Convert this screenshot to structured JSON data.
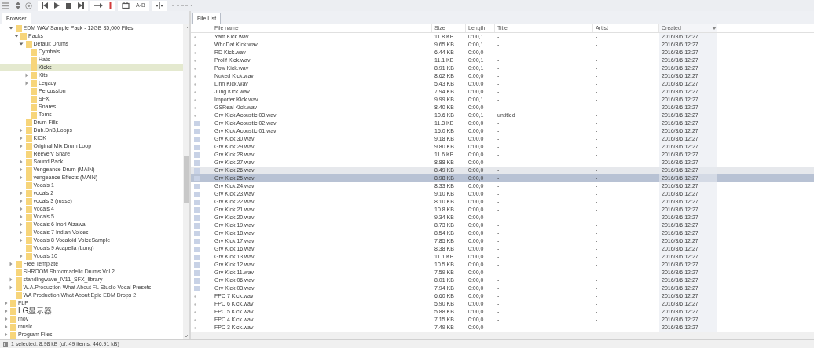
{
  "toolbar": {
    "ab_label": "A-B"
  },
  "browser_tabs": [
    {
      "label": "Browser",
      "selected": true
    }
  ],
  "tree": [
    {
      "children": [
        {
          "label": "EDM WAV Sample Pack - 12GB  35,000 Files",
          "expanded": true,
          "selected": false,
          "children": [
            {
              "label": "Packs",
              "expanded": true,
              "selected": false,
              "children": [
                {
                  "label": "Default Drums",
                  "expanded": true,
                  "selected": false,
                  "children": [
                    {
                      "label": "Cymbals",
                      "selected": false
                    },
                    {
                      "label": "Hats",
                      "selected": false
                    },
                    {
                      "label": "Kicks",
                      "selected": true
                    },
                    {
                      "label": "Kits",
                      "expanded": false,
                      "selected": false
                    },
                    {
                      "label": "Legacy",
                      "expanded": false,
                      "selected": false
                    },
                    {
                      "label": "Percussion",
                      "selected": false
                    },
                    {
                      "label": "SFX",
                      "selected": false
                    },
                    {
                      "label": "Snares",
                      "selected": false
                    },
                    {
                      "label": "Toms",
                      "selected": false
                    }
                  ]
                },
                {
                  "label": "Drum Fills",
                  "selected": false
                },
                {
                  "label": "Dub.DnB,Loops",
                  "expanded": false,
                  "selected": false
                },
                {
                  "label": "KICK",
                  "expanded": false,
                  "selected": false
                },
                {
                  "label": "Original Mix Drum Loop",
                  "expanded": false,
                  "selected": false
                },
                {
                  "label": "Reeverv Share",
                  "selected": false
                },
                {
                  "label": "Sound Pack",
                  "expanded": false,
                  "selected": false
                },
                {
                  "label": "Vengeance Drum (MAIN)",
                  "expanded": false,
                  "selected": false
                },
                {
                  "label": "vengeance Effects (MAIN)",
                  "expanded": false,
                  "selected": false
                },
                {
                  "label": "Vocals 1",
                  "selected": false
                },
                {
                  "label": "vocals 2",
                  "expanded": false,
                  "selected": false
                },
                {
                  "label": "vocals 3 (russe)",
                  "expanded": false,
                  "selected": false
                },
                {
                  "label": "Vocals 4",
                  "expanded": false,
                  "selected": false
                },
                {
                  "label": "Vocals 5",
                  "expanded": false,
                  "selected": false
                },
                {
                  "label": "Vocals 6 Inori Aizawa",
                  "expanded": false,
                  "selected": false
                },
                {
                  "label": "Vocals 7 Indian Voices",
                  "expanded": false,
                  "selected": false
                },
                {
                  "label": "Vocals 8 Vocaloid VoiceSample",
                  "expanded": false,
                  "selected": false
                },
                {
                  "label": "Vocals 9 Acapella (Long)",
                  "selected": false
                },
                {
                  "label": "Vocals 10",
                  "expanded": false,
                  "selected": false
                }
              ]
            }
          ]
        },
        {
          "label": "Free Template",
          "expanded": false,
          "selected": false
        },
        {
          "label": "SHROOM Shroomadelic Drums Vol 2",
          "selected": false
        },
        {
          "label": "standingwave_IV11_SFX_library",
          "expanded": false,
          "selected": false
        },
        {
          "label": "W.A.Production What About FL Studio Vocal Presets",
          "expanded": false,
          "selected": false
        },
        {
          "label": "WA Production What About Epic EDM Drops 2",
          "selected": false
        }
      ]
    },
    {
      "label": "FLP",
      "expanded": false,
      "selected": false
    },
    {
      "label": "LG显示器",
      "expanded": false,
      "selected": false
    },
    {
      "label": "mov",
      "expanded": false,
      "selected": false
    },
    {
      "label": "music",
      "expanded": false,
      "selected": false
    },
    {
      "label": "Program Files",
      "expanded": false,
      "selected": false
    }
  ],
  "status_bar": "1 selected, 8.98 kB (of: 49 items, 446.91 kB)",
  "file_tabs": [
    {
      "label": "File List",
      "selected": true
    }
  ],
  "file_table": {
    "columns": [
      {
        "label": "File name",
        "sorted": false
      },
      {
        "label": "Size",
        "sorted": false
      },
      {
        "label": "Length",
        "sorted": false
      },
      {
        "label": "Title",
        "sorted": false
      },
      {
        "label": "Artist",
        "sorted": false
      },
      {
        "label": "Created",
        "sorted": true
      }
    ],
    "rows": [
      {
        "kind": "dot",
        "cells": [
          "Yam Kick.wav",
          "11.8 KB",
          "0:00,1",
          "-",
          "-",
          "2016/3/6 12:27"
        ],
        "selected": false,
        "highlighted": false
      },
      {
        "kind": "dot",
        "cells": [
          "WhoDat Kick.wav",
          "9.65 KB",
          "0:00,1",
          "-",
          "-",
          "2016/3/6 12:27"
        ],
        "selected": false,
        "highlighted": false
      },
      {
        "kind": "dot",
        "cells": [
          "RD Kick.wav",
          "6.44 KB",
          "0:00,0",
          "-",
          "-",
          "2016/3/6 12:27"
        ],
        "selected": false,
        "highlighted": false
      },
      {
        "kind": "dot",
        "cells": [
          "Prolif Kick.wav",
          "11.1 KB",
          "0:00,1",
          "-",
          "-",
          "2016/3/6 12:27"
        ],
        "selected": false,
        "highlighted": false
      },
      {
        "kind": "dot",
        "cells": [
          "Pow Kick.wav",
          "8.91 KB",
          "0:00,1",
          "-",
          "-",
          "2016/3/6 12:27"
        ],
        "selected": false,
        "highlighted": false
      },
      {
        "kind": "dot",
        "cells": [
          "Nuked Kick.wav",
          "8.62 KB",
          "0:00,0",
          "-",
          "-",
          "2016/3/6 12:27"
        ],
        "selected": false,
        "highlighted": false
      },
      {
        "kind": "dot",
        "cells": [
          "Linn Kick.wav",
          "5.43 KB",
          "0:00,0",
          "-",
          "-",
          "2016/3/6 12:27"
        ],
        "selected": false,
        "highlighted": false
      },
      {
        "kind": "dot",
        "cells": [
          "Jung Kick.wav",
          "7.94 KB",
          "0:00,0",
          "-",
          "-",
          "2016/3/6 12:27"
        ],
        "selected": false,
        "highlighted": false
      },
      {
        "kind": "dot",
        "cells": [
          "Importer Kick.wav",
          "9.99 KB",
          "0:00,1",
          "-",
          "-",
          "2016/3/6 12:27"
        ],
        "selected": false,
        "highlighted": false
      },
      {
        "kind": "dot",
        "cells": [
          "GSReal Kick.wav",
          "8.40 KB",
          "0:00,0",
          "-",
          "-",
          "2016/3/6 12:27"
        ],
        "selected": false,
        "highlighted": false
      },
      {
        "kind": "dot",
        "cells": [
          "Grv Kick Acoustic 03.wav",
          "10.6 KB",
          "0:00,1",
          "untitled",
          "-",
          "2016/3/6 12:27"
        ],
        "selected": false,
        "highlighted": false
      },
      {
        "kind": "square",
        "cells": [
          "Grv Kick Acoustic 02.wav",
          "11.3 KB",
          "0:00,0",
          "-",
          "-",
          "2016/3/6 12:27"
        ],
        "selected": false,
        "highlighted": false
      },
      {
        "kind": "square",
        "cells": [
          "Grv Kick Acoustic 01.wav",
          "15.0 KB",
          "0:00,0",
          "-",
          "-",
          "2016/3/6 12:27"
        ],
        "selected": false,
        "highlighted": false
      },
      {
        "kind": "square",
        "cells": [
          "Grv Kick 30.wav",
          "9.18 KB",
          "0:00,0",
          "-",
          "-",
          "2016/3/6 12:27"
        ],
        "selected": false,
        "highlighted": false
      },
      {
        "kind": "square",
        "cells": [
          "Grv Kick 29.wav",
          "9.80 KB",
          "0:00,0",
          "-",
          "-",
          "2016/3/6 12:27"
        ],
        "selected": false,
        "highlighted": false
      },
      {
        "kind": "square",
        "cells": [
          "Grv Kick 28.wav",
          "11.6 KB",
          "0:00,0",
          "-",
          "-",
          "2016/3/6 12:27"
        ],
        "selected": false,
        "highlighted": false
      },
      {
        "kind": "square",
        "cells": [
          "Grv Kick 27.wav",
          "8.88 KB",
          "0:00,0",
          "-",
          "-",
          "2016/3/6 12:27"
        ],
        "selected": false,
        "highlighted": false
      },
      {
        "kind": "square",
        "cells": [
          "Grv Kick 26.wav",
          "8.49 KB",
          "0:00,0",
          "-",
          "-",
          "2016/3/6 12:27"
        ],
        "selected": false,
        "highlighted": true
      },
      {
        "kind": "square",
        "cells": [
          "Grv Kick 25.wav",
          "8.98 KB",
          "0:00,0",
          "-",
          "-",
          "2016/3/6 12:27"
        ],
        "selected": true,
        "highlighted": false
      },
      {
        "kind": "square",
        "cells": [
          "Grv Kick 24.wav",
          "8.33 KB",
          "0:00,0",
          "-",
          "-",
          "2016/3/6 12:27"
        ],
        "selected": false,
        "highlighted": false
      },
      {
        "kind": "square",
        "cells": [
          "Grv Kick 23.wav",
          "9.10 KB",
          "0:00,0",
          "-",
          "-",
          "2016/3/6 12:27"
        ],
        "selected": false,
        "highlighted": false
      },
      {
        "kind": "square",
        "cells": [
          "Grv Kick 22.wav",
          "8.10 KB",
          "0:00,0",
          "-",
          "-",
          "2016/3/6 12:27"
        ],
        "selected": false,
        "highlighted": false
      },
      {
        "kind": "square",
        "cells": [
          "Grv Kick 21.wav",
          "10.8 KB",
          "0:00,0",
          "-",
          "-",
          "2016/3/6 12:27"
        ],
        "selected": false,
        "highlighted": false
      },
      {
        "kind": "square",
        "cells": [
          "Grv Kick 20.wav",
          "9.34 KB",
          "0:00,0",
          "-",
          "-",
          "2016/3/6 12:27"
        ],
        "selected": false,
        "highlighted": false
      },
      {
        "kind": "square",
        "cells": [
          "Grv Kick 19.wav",
          "8.73 KB",
          "0:00,0",
          "-",
          "-",
          "2016/3/6 12:27"
        ],
        "selected": false,
        "highlighted": false
      },
      {
        "kind": "square",
        "cells": [
          "Grv Kick 18.wav",
          "8.54 KB",
          "0:00,0",
          "-",
          "-",
          "2016/3/6 12:27"
        ],
        "selected": false,
        "highlighted": false
      },
      {
        "kind": "square",
        "cells": [
          "Grv Kick 17.wav",
          "7.85 KB",
          "0:00,0",
          "-",
          "-",
          "2016/3/6 12:27"
        ],
        "selected": false,
        "highlighted": false
      },
      {
        "kind": "square",
        "cells": [
          "Grv Kick 16.wav",
          "8.38 KB",
          "0:00,0",
          "-",
          "-",
          "2016/3/6 12:27"
        ],
        "selected": false,
        "highlighted": false
      },
      {
        "kind": "square",
        "cells": [
          "Grv Kick 13.wav",
          "11.1 KB",
          "0:00,0",
          "-",
          "-",
          "2016/3/6 12:27"
        ],
        "selected": false,
        "highlighted": false
      },
      {
        "kind": "square",
        "cells": [
          "Grv Kick 12.wav",
          "10.5 KB",
          "0:00,0",
          "-",
          "-",
          "2016/3/6 12:27"
        ],
        "selected": false,
        "highlighted": false
      },
      {
        "kind": "square",
        "cells": [
          "Grv Kick 11.wav",
          "7.59 KB",
          "0:00,0",
          "-",
          "-",
          "2016/3/6 12:27"
        ],
        "selected": false,
        "highlighted": false
      },
      {
        "kind": "square",
        "cells": [
          "Grv Kick 06.wav",
          "8.01 KB",
          "0:00,0",
          "-",
          "-",
          "2016/3/6 12:27"
        ],
        "selected": false,
        "highlighted": false
      },
      {
        "kind": "square",
        "cells": [
          "Grv Kick 03.wav",
          "7.94 KB",
          "0:00,0",
          "-",
          "-",
          "2016/3/6 12:27"
        ],
        "selected": false,
        "highlighted": false
      },
      {
        "kind": "dot",
        "cells": [
          "FPC 7 Kick.wav",
          "6.60 KB",
          "0:00,0",
          "-",
          "-",
          "2016/3/6 12:27"
        ],
        "selected": false,
        "highlighted": false
      },
      {
        "kind": "dot",
        "cells": [
          "FPC 6 Kick.wav",
          "5.90 KB",
          "0:00,0",
          "-",
          "-",
          "2016/3/6 12:27"
        ],
        "selected": false,
        "highlighted": false
      },
      {
        "kind": "dot",
        "cells": [
          "FPC 5 Kick.wav",
          "5.88 KB",
          "0:00,0",
          "-",
          "-",
          "2016/3/6 12:27"
        ],
        "selected": false,
        "highlighted": false
      },
      {
        "kind": "dot",
        "cells": [
          "FPC 4 Kick.wav",
          "7.15 KB",
          "0:00,0",
          "-",
          "-",
          "2016/3/6 12:27"
        ],
        "selected": false,
        "highlighted": false
      },
      {
        "kind": "dot",
        "cells": [
          "FPC 3 Kick.wav",
          "7.49 KB",
          "0:00,0",
          "-",
          "-",
          "2016/3/6 12:27"
        ],
        "selected": false,
        "highlighted": false
      }
    ]
  }
}
